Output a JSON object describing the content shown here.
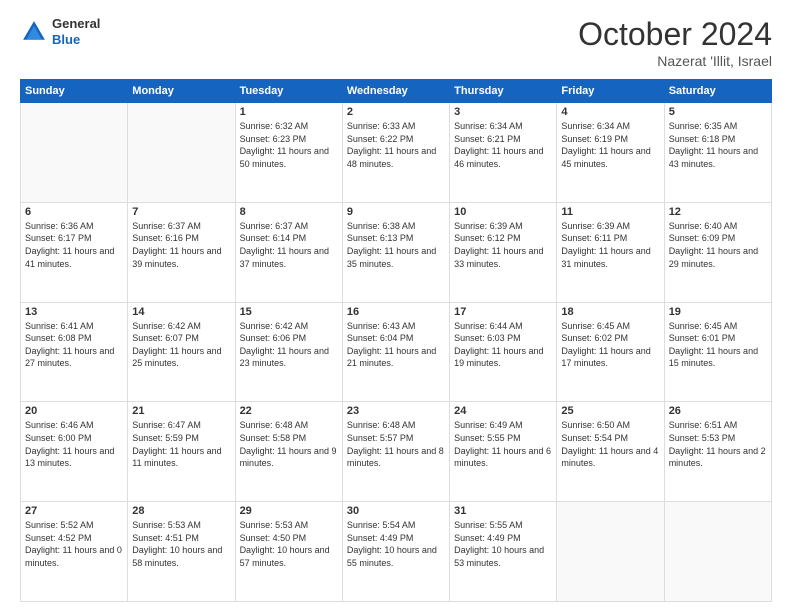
{
  "logo": {
    "line1": "General",
    "line2": "Blue"
  },
  "header": {
    "month": "October 2024",
    "location": "Nazerat 'Illit, Israel"
  },
  "weekdays": [
    "Sunday",
    "Monday",
    "Tuesday",
    "Wednesday",
    "Thursday",
    "Friday",
    "Saturday"
  ],
  "weeks": [
    [
      {
        "day": "",
        "info": ""
      },
      {
        "day": "",
        "info": ""
      },
      {
        "day": "1",
        "info": "Sunrise: 6:32 AM\nSunset: 6:23 PM\nDaylight: 11 hours and 50 minutes."
      },
      {
        "day": "2",
        "info": "Sunrise: 6:33 AM\nSunset: 6:22 PM\nDaylight: 11 hours and 48 minutes."
      },
      {
        "day": "3",
        "info": "Sunrise: 6:34 AM\nSunset: 6:21 PM\nDaylight: 11 hours and 46 minutes."
      },
      {
        "day": "4",
        "info": "Sunrise: 6:34 AM\nSunset: 6:19 PM\nDaylight: 11 hours and 45 minutes."
      },
      {
        "day": "5",
        "info": "Sunrise: 6:35 AM\nSunset: 6:18 PM\nDaylight: 11 hours and 43 minutes."
      }
    ],
    [
      {
        "day": "6",
        "info": "Sunrise: 6:36 AM\nSunset: 6:17 PM\nDaylight: 11 hours and 41 minutes."
      },
      {
        "day": "7",
        "info": "Sunrise: 6:37 AM\nSunset: 6:16 PM\nDaylight: 11 hours and 39 minutes."
      },
      {
        "day": "8",
        "info": "Sunrise: 6:37 AM\nSunset: 6:14 PM\nDaylight: 11 hours and 37 minutes."
      },
      {
        "day": "9",
        "info": "Sunrise: 6:38 AM\nSunset: 6:13 PM\nDaylight: 11 hours and 35 minutes."
      },
      {
        "day": "10",
        "info": "Sunrise: 6:39 AM\nSunset: 6:12 PM\nDaylight: 11 hours and 33 minutes."
      },
      {
        "day": "11",
        "info": "Sunrise: 6:39 AM\nSunset: 6:11 PM\nDaylight: 11 hours and 31 minutes."
      },
      {
        "day": "12",
        "info": "Sunrise: 6:40 AM\nSunset: 6:09 PM\nDaylight: 11 hours and 29 minutes."
      }
    ],
    [
      {
        "day": "13",
        "info": "Sunrise: 6:41 AM\nSunset: 6:08 PM\nDaylight: 11 hours and 27 minutes."
      },
      {
        "day": "14",
        "info": "Sunrise: 6:42 AM\nSunset: 6:07 PM\nDaylight: 11 hours and 25 minutes."
      },
      {
        "day": "15",
        "info": "Sunrise: 6:42 AM\nSunset: 6:06 PM\nDaylight: 11 hours and 23 minutes."
      },
      {
        "day": "16",
        "info": "Sunrise: 6:43 AM\nSunset: 6:04 PM\nDaylight: 11 hours and 21 minutes."
      },
      {
        "day": "17",
        "info": "Sunrise: 6:44 AM\nSunset: 6:03 PM\nDaylight: 11 hours and 19 minutes."
      },
      {
        "day": "18",
        "info": "Sunrise: 6:45 AM\nSunset: 6:02 PM\nDaylight: 11 hours and 17 minutes."
      },
      {
        "day": "19",
        "info": "Sunrise: 6:45 AM\nSunset: 6:01 PM\nDaylight: 11 hours and 15 minutes."
      }
    ],
    [
      {
        "day": "20",
        "info": "Sunrise: 6:46 AM\nSunset: 6:00 PM\nDaylight: 11 hours and 13 minutes."
      },
      {
        "day": "21",
        "info": "Sunrise: 6:47 AM\nSunset: 5:59 PM\nDaylight: 11 hours and 11 minutes."
      },
      {
        "day": "22",
        "info": "Sunrise: 6:48 AM\nSunset: 5:58 PM\nDaylight: 11 hours and 9 minutes."
      },
      {
        "day": "23",
        "info": "Sunrise: 6:48 AM\nSunset: 5:57 PM\nDaylight: 11 hours and 8 minutes."
      },
      {
        "day": "24",
        "info": "Sunrise: 6:49 AM\nSunset: 5:55 PM\nDaylight: 11 hours and 6 minutes."
      },
      {
        "day": "25",
        "info": "Sunrise: 6:50 AM\nSunset: 5:54 PM\nDaylight: 11 hours and 4 minutes."
      },
      {
        "day": "26",
        "info": "Sunrise: 6:51 AM\nSunset: 5:53 PM\nDaylight: 11 hours and 2 minutes."
      }
    ],
    [
      {
        "day": "27",
        "info": "Sunrise: 5:52 AM\nSunset: 4:52 PM\nDaylight: 11 hours and 0 minutes."
      },
      {
        "day": "28",
        "info": "Sunrise: 5:53 AM\nSunset: 4:51 PM\nDaylight: 10 hours and 58 minutes."
      },
      {
        "day": "29",
        "info": "Sunrise: 5:53 AM\nSunset: 4:50 PM\nDaylight: 10 hours and 57 minutes."
      },
      {
        "day": "30",
        "info": "Sunrise: 5:54 AM\nSunset: 4:49 PM\nDaylight: 10 hours and 55 minutes."
      },
      {
        "day": "31",
        "info": "Sunrise: 5:55 AM\nSunset: 4:49 PM\nDaylight: 10 hours and 53 minutes."
      },
      {
        "day": "",
        "info": ""
      },
      {
        "day": "",
        "info": ""
      }
    ]
  ]
}
